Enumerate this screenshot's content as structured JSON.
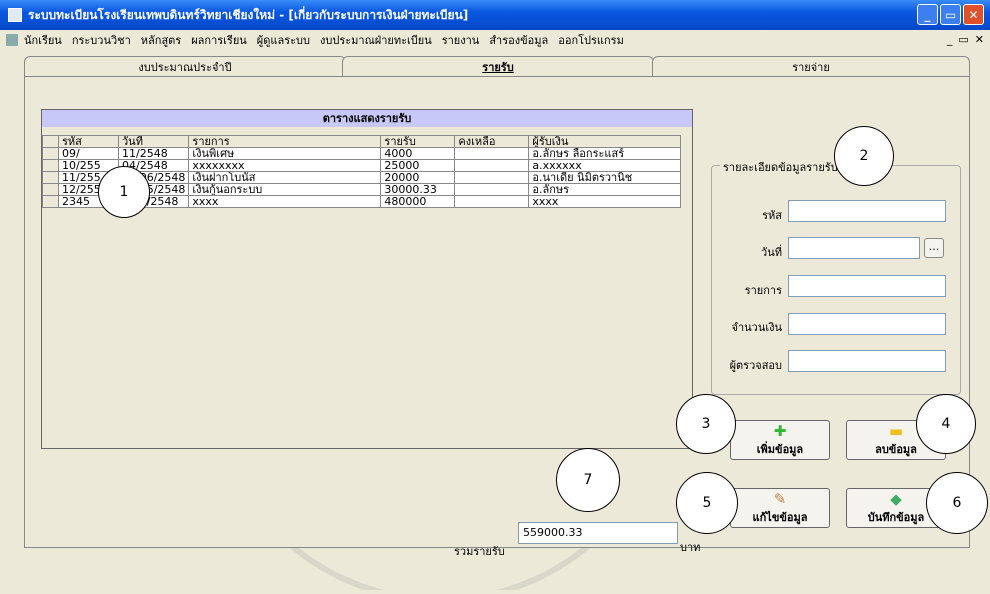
{
  "window": {
    "title": "ระบบทะเบียนโรงเรียนเทพบดินทร์วิทยาเชียงใหม่ - [เกี่ยวกับระบบการเงินฝ่ายทะเบียน]"
  },
  "menu": {
    "items": [
      "นักเรียน",
      "กระบวนวิชา",
      "หลักสูตร",
      "ผลการเรียน",
      "ผู้ดูแลระบบ",
      "งบประมาณฝ่ายทะเบียน",
      "รายงาน",
      "สำรองข้อมูล",
      "ออกโปรแกรม"
    ],
    "mdi_controls": [
      "_",
      "▭",
      "✕"
    ]
  },
  "tabs": [
    "งบประมาณประจำปี",
    "รายรับ",
    "รายจ่าย"
  ],
  "grid": {
    "title": "ตารางแสดงรายรับ",
    "columns": [
      "รหัส",
      "วันที่",
      "รายการ",
      "รายรับ",
      "คงเหลือ",
      "ผู้รับเงิน"
    ],
    "rows": [
      [
        "09/",
        "11/2548",
        "เงินพิเศษ",
        "4000",
        "",
        "อ.ลักษร ลือกระแสร์"
      ],
      [
        "10/255",
        "04/2548",
        "xxxxxxxx",
        "25000",
        "",
        "a.xxxxxx"
      ],
      [
        "11/255",
        "15/06/2548",
        "เงินฝากโบนัส",
        "20000",
        "",
        "อ.นาเดีย นิมิตรวานิช"
      ],
      [
        "12/255",
        "14/05/2548",
        "เงินกู้นอกระบบ",
        "30000.33",
        "",
        "อ.ลักษร"
      ],
      [
        "2345",
        "5/10/2548",
        "xxxx",
        "480000",
        "",
        "xxxx"
      ]
    ]
  },
  "detail": {
    "legend": "รายละเอียดข้อมูลรายรับ",
    "labels": [
      "รหัส",
      "วันที่",
      "รายการ",
      "จำนวนเงิน",
      "ผู้ตรวจสอบ"
    ],
    "dots": "..."
  },
  "buttons": {
    "add": "เพิ่มข้อมูล",
    "delete": "ลบข้อมูล",
    "edit": "แก้ไขข้อมูล",
    "save": "บันทึกข้อมูล"
  },
  "total": {
    "label": "รวมรายรับ",
    "value": "559000.33",
    "unit": "บาท"
  },
  "callouts": [
    "1",
    "2",
    "3",
    "4",
    "5",
    "6",
    "7"
  ],
  "colors": {
    "titlebar": "#0a58e0",
    "grid_title": "#c8c8f8",
    "add_icon": "#2db82d",
    "delete_icon": "#f0c020"
  }
}
